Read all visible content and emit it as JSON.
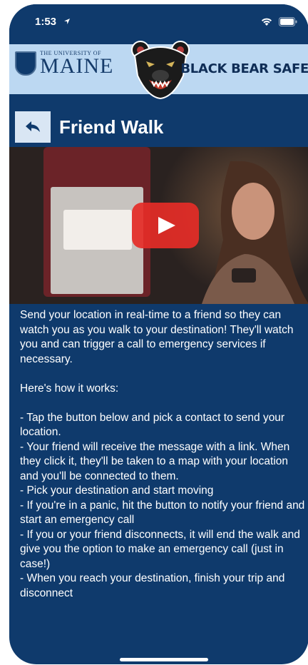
{
  "status_bar": {
    "time": "1:53",
    "icons": [
      "location-arrow-icon",
      "wifi-icon",
      "battery-icon"
    ]
  },
  "banner": {
    "university_line": "THE UNIVERSITY OF",
    "university_name": "MAINE",
    "app_name": "BLACK BEAR SAFE",
    "mascot": "black-bear-icon"
  },
  "header": {
    "back_icon": "back-arrow-icon",
    "title": "Friend Walk"
  },
  "video": {
    "play_icon": "play-icon"
  },
  "content": {
    "intro": "Send your location in real-time to a friend so they can watch you as you walk to your destination! They'll watch you and can trigger a call to emergency services if necessary.",
    "how_heading": "Here's how it works:",
    "steps": [
      "- Tap the button below and pick a contact to send your location.",
      "- Your friend will receive the message with a link. When they click it, they'll be taken to a map with your location and you'll be connected to them.",
      "- Pick your destination and start moving",
      "- If you're in a panic, hit the button to notify your friend and start an emergency call",
      "- If you or your friend disconnects, it will end the walk and give you the option to make an emergency call (just in case!)",
      "- When you reach your destination, finish your trip and disconnect"
    ]
  },
  "colors": {
    "background": "#0f3a6c",
    "banner": "#bcd8f2",
    "back_button": "#d9e6f4",
    "play_red": "#e52d27"
  }
}
